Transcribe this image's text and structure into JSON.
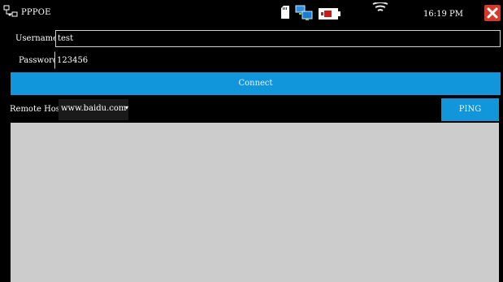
{
  "window": {
    "title": "PPPOE",
    "time": "16:19 PM",
    "app_icon": "network-settings-icon",
    "status_icons": [
      "sd-card-icon",
      "network-computers-icon",
      "battery-icon",
      "wifi-icon"
    ],
    "close_icon": "close-icon"
  },
  "form": {
    "username_label": "Username:",
    "username_value": "test",
    "password_label": "Password:",
    "password_value": "123456",
    "connect_label": "Connect",
    "remote_host_label": "Remote Host:",
    "remote_host_value": "www.baidu.com",
    "ping_label": "PING"
  },
  "colors": {
    "background": "#000000",
    "accent_button": "#1296db",
    "close_button": "#d43a2c",
    "output_area": "#cccccc"
  }
}
